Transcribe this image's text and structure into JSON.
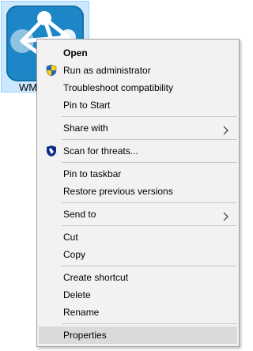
{
  "desktop_icon": {
    "label": "WM",
    "icon": "network-graph-icon",
    "tile_color": "#1c86c6"
  },
  "menu": {
    "items": [
      {
        "label": "Open",
        "bold": true
      },
      {
        "label": "Run as administrator",
        "icon": "uac-shield-icon"
      },
      {
        "label": "Troubleshoot compatibility"
      },
      {
        "label": "Pin to Start"
      },
      {
        "label": "Share with",
        "submenu": true
      },
      {
        "label": "Scan for threats...",
        "icon": "defender-shield-icon"
      },
      {
        "label": "Pin to taskbar"
      },
      {
        "label": "Restore previous versions"
      },
      {
        "label": "Send to",
        "submenu": true
      },
      {
        "label": "Cut"
      },
      {
        "label": "Copy"
      },
      {
        "label": "Create shortcut"
      },
      {
        "label": "Delete"
      },
      {
        "label": "Rename"
      },
      {
        "label": "Properties",
        "hovered": true
      }
    ]
  },
  "colors": {
    "menu_background": "#f2f2f2",
    "hover_background": "#dadada",
    "selection_background": "#cce8ff"
  }
}
